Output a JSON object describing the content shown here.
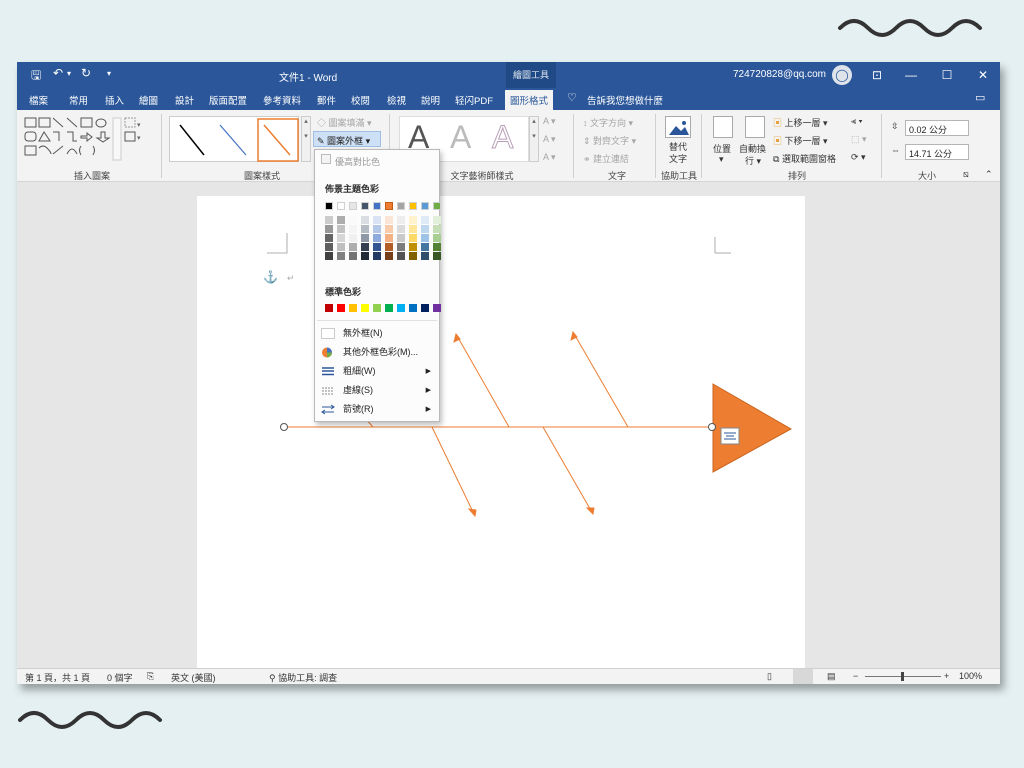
{
  "titlebar": {
    "qat_icons": [
      "save-icon",
      "undo-icon",
      "redo-icon",
      "customize-icon"
    ],
    "doc_title": "文件1  -  Word",
    "context_group": "繪圖工具",
    "account": "724720828@qq.com"
  },
  "tabs": [
    "檔案",
    "常用",
    "插入",
    "繪圖",
    "設計",
    "版面配置",
    "參考資料",
    "郵件",
    "校閱",
    "檢視",
    "說明",
    "轻闪PDF",
    "圖形格式"
  ],
  "active_tab": "圖形格式",
  "tell_me": "告訴我您想做什麼",
  "ribbon": {
    "groups": [
      "插入圖案",
      "圖案樣式",
      "文字藝術師樣式",
      "文字",
      "協助工具",
      "排列",
      "大小"
    ],
    "shape_fill": "圖案填滿",
    "shape_outline": "圖案外框",
    "text_direction": "文字方向",
    "align_text": "對齊文字",
    "create_link": "建立連結",
    "alt_text": [
      "替代",
      "文字"
    ],
    "position": "位置",
    "wrap_text": [
      "自動換",
      "行"
    ],
    "bring_forward": "上移一層",
    "send_backward": "下移一層",
    "selection_pane": "選取範圍窗格",
    "height": "0.02 公分",
    "width": "14.71 公分",
    "wordart_letter": "A"
  },
  "outline_menu": {
    "highlight": "優高對比色",
    "theme_colors_title": "佈景主題色彩",
    "standard_colors_title": "標準色彩",
    "no_outline": "無外框(N)",
    "more_colors": "其他外框色彩(M)...",
    "weight": "粗細(W)",
    "dashes": "虛線(S)",
    "arrows": "箭號(R)"
  },
  "colors": {
    "theme_top": [
      "#000000",
      "#ffffff",
      "#e7e6e6",
      "#44546a",
      "#4472c4",
      "#ed7d31",
      "#a5a5a5",
      "#ffc000",
      "#5b9bd5",
      "#70ad47"
    ],
    "standard": [
      "#c00000",
      "#ff0000",
      "#ffc000",
      "#ffff00",
      "#92d050",
      "#00b050",
      "#00b0f0",
      "#0070c0",
      "#002060",
      "#7030a0"
    ],
    "accent": "#2b579a",
    "shape_orange": "#ed7d31"
  },
  "statusbar": {
    "page": "第 1 頁，共 1 頁",
    "words": "0 個字",
    "language": "英文 (美國)",
    "accessibility": "協助工具: 調查",
    "zoom": "100%"
  }
}
